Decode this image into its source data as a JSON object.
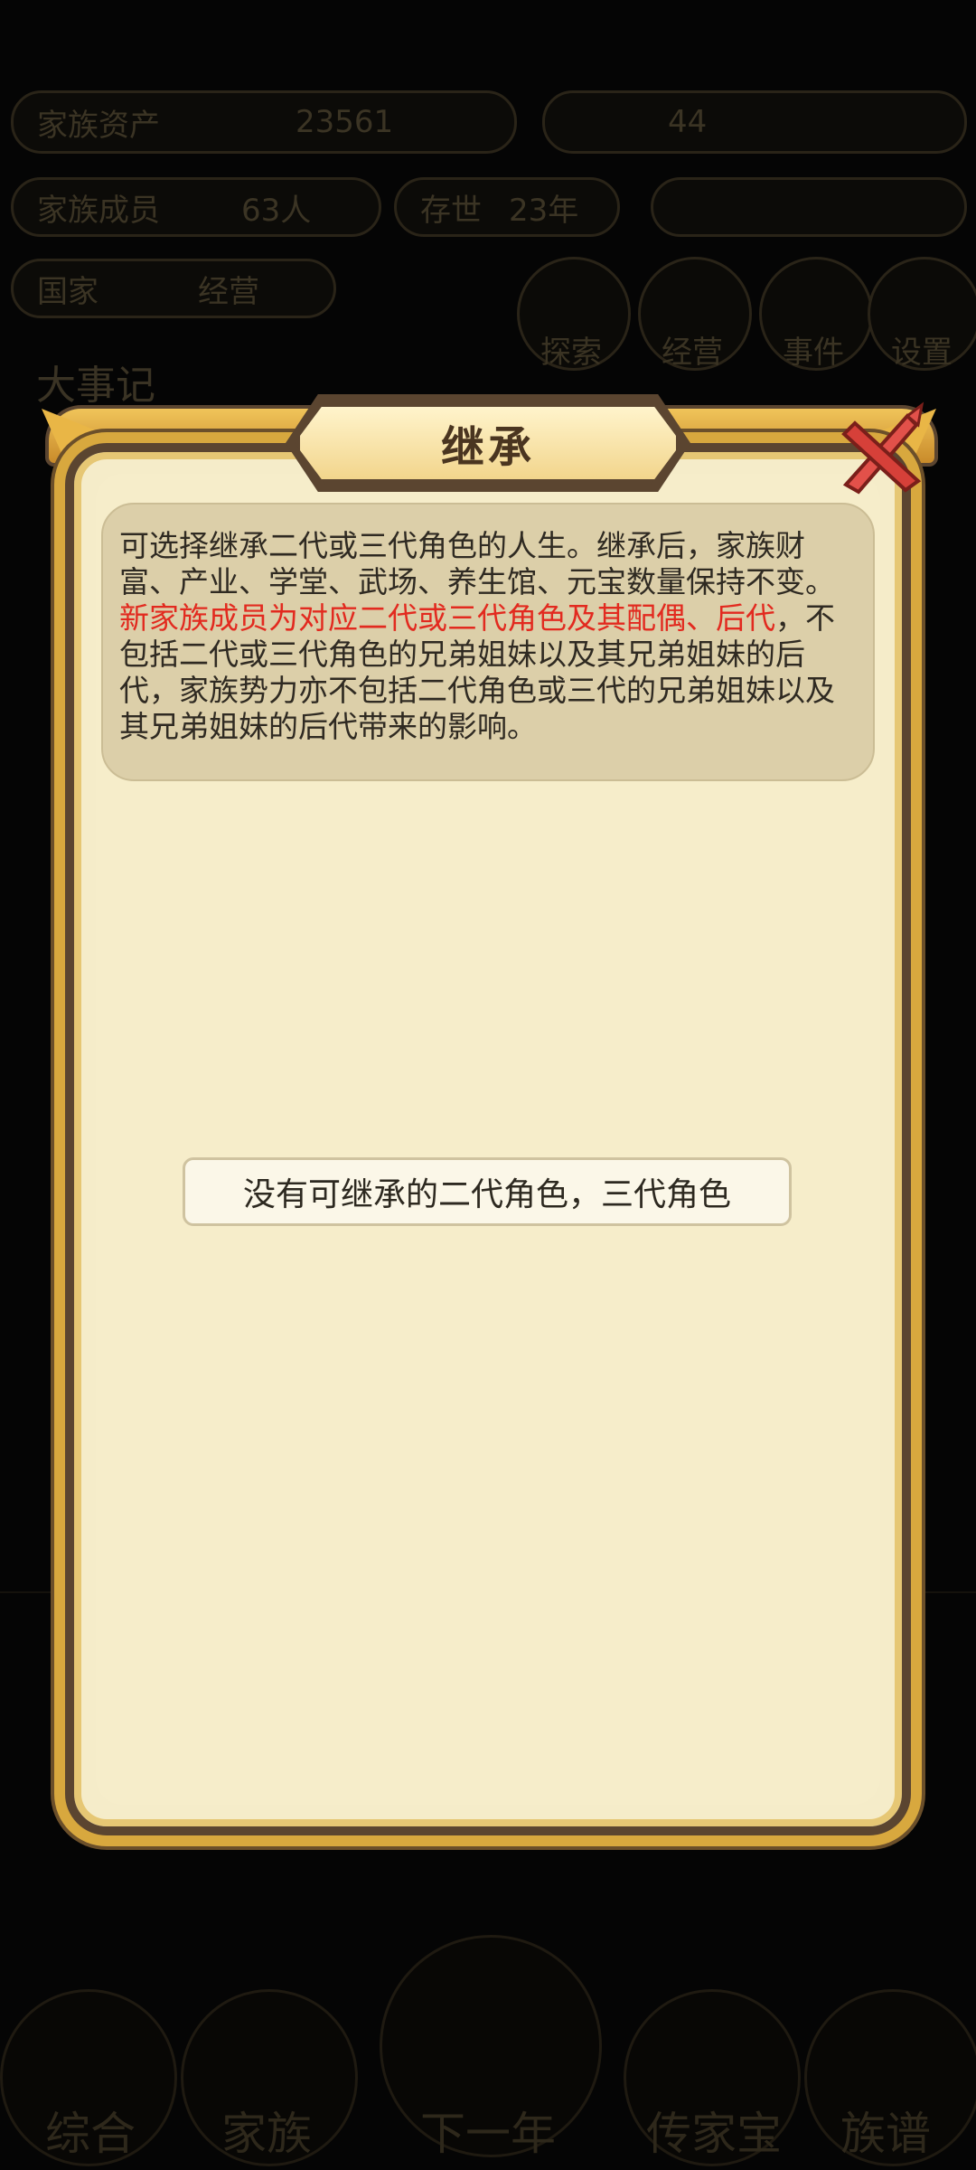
{
  "background": {
    "top_pills": [
      "家族资产",
      "23561",
      "44"
    ],
    "info_pills": [
      "家族成员",
      "63人",
      "存世",
      "23年"
    ],
    "row3_pills": [
      "国家",
      "经营"
    ],
    "round_buttons": [
      "探索",
      "经营",
      "事件",
      "设置"
    ],
    "log_title": "大事记",
    "bottom_nav": [
      "综合",
      "家族",
      "下一年",
      "传家宝",
      "族谱"
    ]
  },
  "dialog": {
    "title": "继承",
    "close_icon": "close-icon",
    "info_part1": "可选择继承二代或三代角色的人生。继承后，家族财富、产业、学堂、武场、养生馆、元宝数量保持不变。",
    "info_highlight": "新家族成员为对应二代或三代角色及其配偶、后代",
    "info_part2": "，不包括二代或三代角色的兄弟姐妹以及其兄弟姐妹的后代，家族势力亦不包括二代角色或三代的兄弟姐妹以及其兄弟姐妹的后代带来的影响。",
    "empty_message": "没有可继承的二代角色，三代角色"
  },
  "colors": {
    "highlight": "#e22a1f",
    "panel": "#f5ecc9",
    "frame": "#d8a83e"
  }
}
